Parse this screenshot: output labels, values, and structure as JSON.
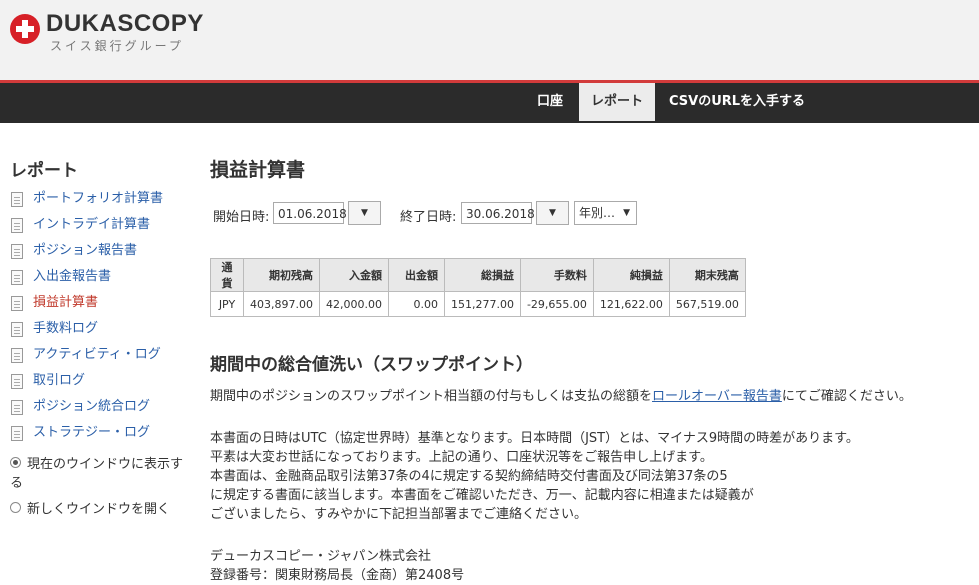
{
  "header": {
    "logo_name": "DUKASCOPY",
    "logo_sub": "スイス銀行グループ"
  },
  "nav": {
    "items": [
      {
        "label": "口座"
      },
      {
        "label": "レポート",
        "active": true
      },
      {
        "label": "CSVのURLを入手する"
      }
    ]
  },
  "sidebar": {
    "title": "レポート",
    "items": [
      {
        "label": "ポートフォリオ計算書"
      },
      {
        "label": "イントラデイ計算書"
      },
      {
        "label": "ポジション報告書"
      },
      {
        "label": "入出金報告書"
      },
      {
        "label": "損益計算書",
        "current": true
      },
      {
        "label": "手数料ログ"
      },
      {
        "label": "アクティビティ・ログ"
      },
      {
        "label": "取引ログ"
      },
      {
        "label": "ポジション統合ログ"
      },
      {
        "label": "ストラテジー・ログ"
      }
    ],
    "radio_current_window_line1": "現在のウインドウに表示す",
    "radio_current_window_line2": "る",
    "radio_new_window": "新しくウインドウを開く"
  },
  "main": {
    "title": "損益計算書",
    "start_label": "開始日時:",
    "start_value": "01.06.2018",
    "end_label": "終了日時:",
    "end_value": "30.06.2018",
    "period_select": "年別…",
    "dropdown_glyph": "▼",
    "table": {
      "headers": [
        "通貨",
        "期初残高",
        "入金額",
        "出金額",
        "総損益",
        "手数料",
        "純損益",
        "期末残高"
      ],
      "rows": [
        [
          "JPY",
          "403,897.00",
          "42,000.00",
          "0.00",
          "151,277.00",
          "-29,655.00",
          "121,622.00",
          "567,519.00"
        ]
      ]
    },
    "swap_title": "期間中の総合値洗い（スワップポイント）",
    "swap_text_before": "期間中のポジションのスワップポイント相当額の付与もしくは支払の総額を",
    "swap_link": "ロールオーバー報告書",
    "swap_text_after": "にてご確認ください。",
    "notes": [
      "本書面の日時はUTC（協定世界時）基準となります。日本時間（JST）とは、マイナス9時間の時差があります。",
      "平素は大変お世話になっております。上記の通り、口座状況等をご報告申し上げます。",
      "本書面は、金融商品取引法第37条の4に規定する契約締結時交付書面及び同法第37条の5",
      "に規定する書面に該当します。本書面をご確認いただき、万一、記載内容に相違または疑義が",
      "ございましたら、すみやかに下記担当部署までご連絡ください。"
    ],
    "company": "デューカスコピー・ジャパン株式会社",
    "registration": "登録番号：関東財務局長（金商）第2408号"
  }
}
